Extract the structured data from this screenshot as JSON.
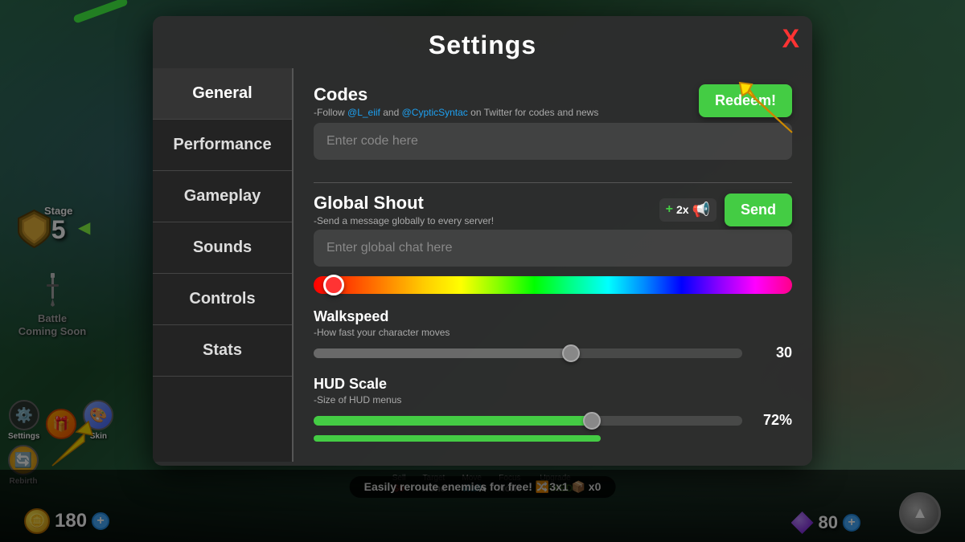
{
  "game": {
    "stage_label": "Stage",
    "stage_num": "5",
    "battle_coming_soon": "Battle\nComing Soon",
    "coins": "180",
    "gems": "80",
    "tip": "Easily reroute enemies for free! 🔀3x1 📦 x0"
  },
  "toolbar": {
    "sell_label": "Sell",
    "sell_value": "$0",
    "target_label": "Target",
    "target_value": "None",
    "move_label": "Move",
    "move_value": "Wall",
    "focus_label": "Focus",
    "focus_value": "None",
    "upgrade_label": "Upgrade",
    "upgrade_value": "MAXED"
  },
  "bottom_icons": [
    {
      "icon": "⚙️",
      "label": "Settings"
    },
    {
      "icon": "🎁",
      "label": ""
    },
    {
      "icon": "🎨",
      "label": "Skin"
    },
    {
      "icon": "🔄",
      "label": "Rebirth"
    }
  ],
  "modal": {
    "title": "Settings",
    "close_label": "X",
    "nav_items": [
      {
        "id": "general",
        "label": "General"
      },
      {
        "id": "performance",
        "label": "Performance"
      },
      {
        "id": "gameplay",
        "label": "Gameplay"
      },
      {
        "id": "sounds",
        "label": "Sounds"
      },
      {
        "id": "controls",
        "label": "Controls"
      },
      {
        "id": "stats",
        "label": "Stats"
      }
    ],
    "active_tab": "general",
    "codes": {
      "title": "Codes",
      "subtitle": "-Follow @L_eiif and @CypticSyntac on Twitter for codes and news",
      "twitter1": "@L_eiif",
      "twitter2": "@CypticSyntac",
      "redeem_label": "Redeem!",
      "input_placeholder": "Enter code here"
    },
    "global_shout": {
      "title": "Global Shout",
      "subtitle": "-Send a message globally to every server!",
      "multiplier": "2x",
      "send_label": "Send",
      "input_placeholder": "Enter global chat here"
    },
    "walkspeed": {
      "title": "Walkspeed",
      "desc": "-How fast your character moves",
      "value": "30",
      "percent": 60
    },
    "hud_scale": {
      "title": "HUD Scale",
      "desc": "-Size of HUD menus",
      "value": "72%",
      "percent": 65
    }
  }
}
